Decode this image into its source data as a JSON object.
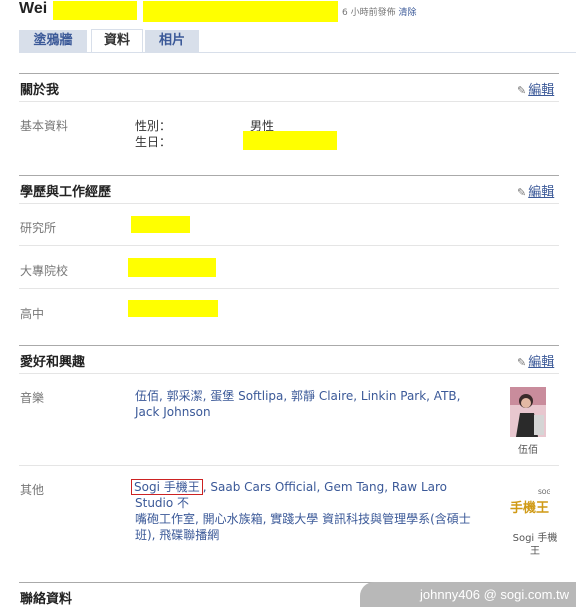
{
  "header": {
    "name": "Wei",
    "time_text": "6 小時前發佈",
    "time_link": "清除"
  },
  "tabs": [
    {
      "label": "塗鴉牆"
    },
    {
      "label": "資料"
    },
    {
      "label": "相片"
    }
  ],
  "edit_label": "編輯",
  "about": {
    "title": "關於我",
    "basic_label": "基本資料",
    "gender_label": "性別：",
    "gender_value": "男性",
    "birthday_label": "生日："
  },
  "education": {
    "title": "學歷與工作經歷",
    "rows": [
      {
        "label": "研究所"
      },
      {
        "label": "大專院校"
      },
      {
        "label": "高中"
      }
    ]
  },
  "interests": {
    "title": "愛好和興趣",
    "music_label": "音樂",
    "music_text": "伍佰, 郭采潔, 蛋堡 Softlipa, 郭靜 Claire, Linkin Park, ATB, Jack Johnson",
    "music_thumb_caption": "伍佰",
    "other_label": "其他",
    "other_highlight": "Sogi 手機王",
    "other_text_line1": ", Saab Cars Official, Gem Tang, Raw Laro Studio 不",
    "other_text_line2": "嘴砲工作室, 開心水族箱, 實踐大學 資訊科技與管理學系(含碩士",
    "other_text_line3": "班), 飛碟聯播網",
    "other_thumb_caption_1": "Sogi 手機",
    "other_thumb_caption_2": "王",
    "other_thumb_logo": "手機王"
  },
  "contact": {
    "title": "聯絡資料"
  },
  "watermark": "johnny406  @ sogi.com.tw",
  "colors": {
    "link": "#3b5998",
    "redaction": "#ffff00",
    "tab_bg": "#d8dfea"
  }
}
